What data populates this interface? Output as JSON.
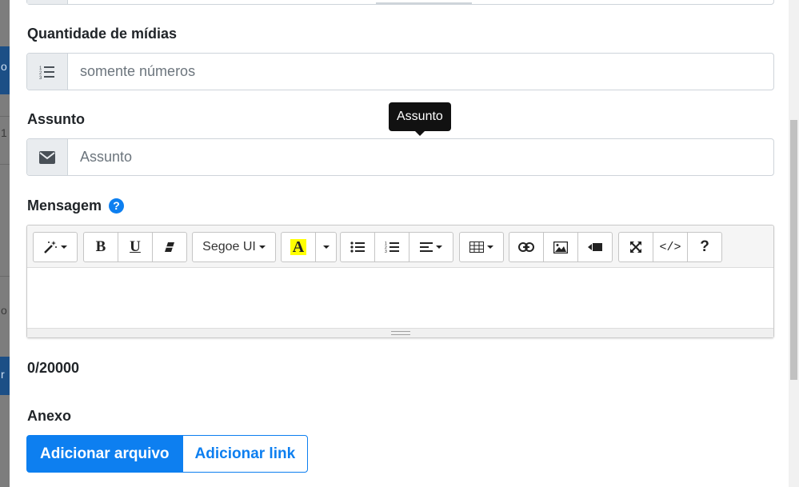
{
  "background": {
    "chars": [
      "o",
      "1",
      "o",
      "r"
    ]
  },
  "fields": {
    "quantity": {
      "label": "Quantidade de mídias",
      "placeholder": "somente números",
      "icon": "list-ol-icon"
    },
    "subject": {
      "label": "Assunto",
      "placeholder": "Assunto",
      "icon": "envelope-icon",
      "tooltip": "Assunto"
    }
  },
  "message": {
    "label": "Mensagem",
    "help_icon": "?",
    "toolbar": {
      "font_name": "Segoe UI",
      "color_letter": "A",
      "bold": "B",
      "underline": "U",
      "code": "</>",
      "help": "?"
    },
    "counter": "0/20000"
  },
  "attachment": {
    "label": "Anexo",
    "add_file": "Adicionar arquivo",
    "add_link": "Adicionar link"
  },
  "colors": {
    "primary": "#0d7ff0",
    "highlight": "#ffff00",
    "tooltip_bg": "#111111"
  }
}
